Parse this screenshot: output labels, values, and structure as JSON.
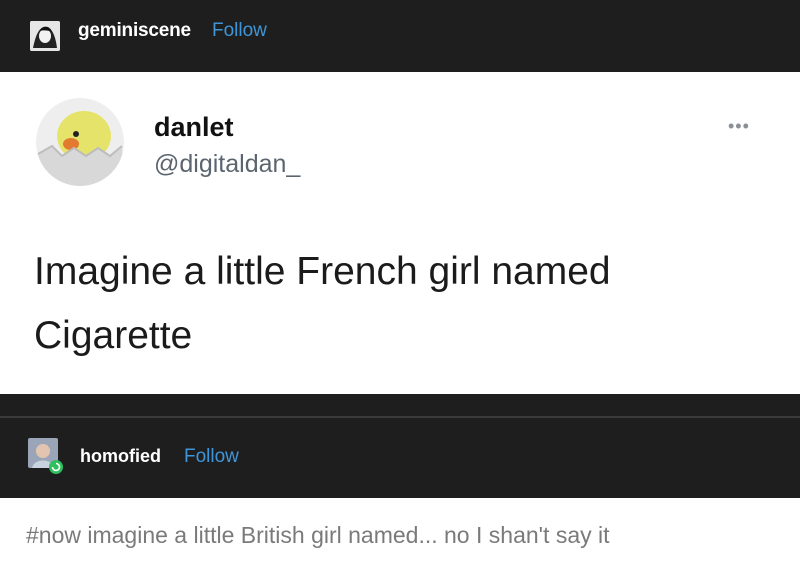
{
  "header": {
    "username": "geminiscene",
    "follow_label": "Follow"
  },
  "tweet": {
    "display_name": "danlet",
    "handle": "@digitaldan_",
    "more_label": "•••",
    "text_line1": "Imagine a little French girl named",
    "text_line2": "Cigarette"
  },
  "reblog": {
    "username": "homofied",
    "follow_label": "Follow",
    "tags_text": "#now imagine a little British girl named... no I shan't say it"
  },
  "colors": {
    "follow": "#3f95d8",
    "dark_bg": "#1e1e1e",
    "card_bg": "#ffffff"
  }
}
